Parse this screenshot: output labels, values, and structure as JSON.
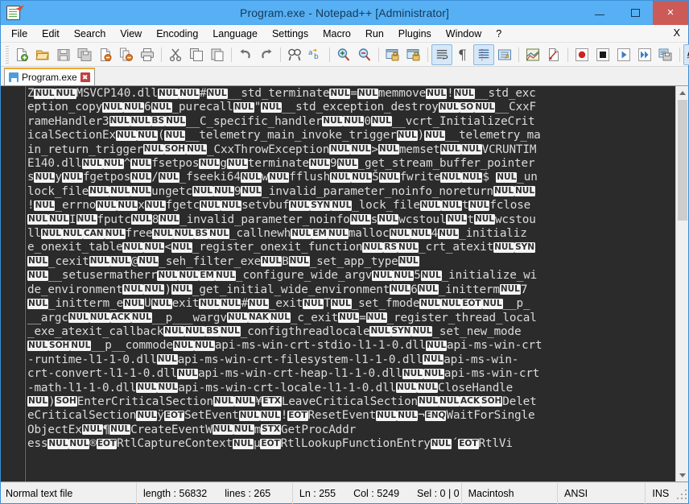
{
  "window": {
    "title": "Program.exe - Notepad++ [Administrator]",
    "icon": "notepad-plus-plus-icon",
    "minimize_label": "–",
    "maximize_label": "□",
    "close_label": "×"
  },
  "menu": {
    "items": [
      {
        "label": "File",
        "accel": "F"
      },
      {
        "label": "Edit",
        "accel": "E"
      },
      {
        "label": "Search",
        "accel": "S"
      },
      {
        "label": "View",
        "accel": "V"
      },
      {
        "label": "Encoding",
        "accel": "n"
      },
      {
        "label": "Language",
        "accel": "L"
      },
      {
        "label": "Settings",
        "accel": "t"
      },
      {
        "label": "Macro",
        "accel": "M"
      },
      {
        "label": "Run",
        "accel": "R"
      },
      {
        "label": "Plugins",
        "accel": "P"
      },
      {
        "label": "Window",
        "accel": "W"
      },
      {
        "label": "?",
        "accel": "?"
      }
    ],
    "close_doc_label": "X"
  },
  "toolbar": {
    "buttons": [
      {
        "name": "new-file-icon",
        "tip": "New"
      },
      {
        "name": "open-file-icon",
        "tip": "Open"
      },
      {
        "name": "save-icon",
        "tip": "Save"
      },
      {
        "name": "save-all-icon",
        "tip": "Save All"
      },
      {
        "name": "close-file-icon",
        "tip": "Close"
      },
      {
        "name": "close-all-files-icon",
        "tip": "Close All"
      },
      {
        "name": "print-icon",
        "tip": "Print"
      },
      {
        "name": "separator",
        "tip": ""
      },
      {
        "name": "cut-icon",
        "tip": "Cut"
      },
      {
        "name": "copy-icon",
        "tip": "Copy"
      },
      {
        "name": "paste-icon",
        "tip": "Paste"
      },
      {
        "name": "separator",
        "tip": ""
      },
      {
        "name": "undo-icon",
        "tip": "Undo"
      },
      {
        "name": "redo-icon",
        "tip": "Redo"
      },
      {
        "name": "separator",
        "tip": ""
      },
      {
        "name": "find-icon",
        "tip": "Find"
      },
      {
        "name": "replace-icon",
        "tip": "Replace"
      },
      {
        "name": "separator",
        "tip": ""
      },
      {
        "name": "zoom-in-icon",
        "tip": "Zoom In"
      },
      {
        "name": "zoom-out-icon",
        "tip": "Zoom Out"
      },
      {
        "name": "separator",
        "tip": ""
      },
      {
        "name": "sync-vertical-icon",
        "tip": "Synchronize Vertical Scrolling"
      },
      {
        "name": "sync-horizontal-icon",
        "tip": "Synchronize Horizontal Scrolling"
      },
      {
        "name": "separator",
        "tip": ""
      },
      {
        "name": "word-wrap-icon",
        "tip": "Word wrap",
        "active": true
      },
      {
        "name": "show-all-characters-icon",
        "tip": "Show All Characters"
      },
      {
        "name": "indent-guide-icon",
        "tip": "Show Indent Guide",
        "active": true
      },
      {
        "name": "user-defined-dialog-icon",
        "tip": "User Defined Dialogue"
      },
      {
        "name": "separator",
        "tip": ""
      },
      {
        "name": "document-map-icon",
        "tip": "Document Map"
      },
      {
        "name": "function-list-icon",
        "tip": "Function List"
      },
      {
        "name": "separator",
        "tip": ""
      },
      {
        "name": "record-macro-icon",
        "tip": "Start Recording"
      },
      {
        "name": "stop-macro-icon",
        "tip": "Stop Recording"
      },
      {
        "name": "play-macro-icon",
        "tip": "Playback"
      },
      {
        "name": "run-macro-multiple-icon",
        "tip": "Run a Macro Multiple Times"
      },
      {
        "name": "save-macro-icon",
        "tip": "Save Current Recorded Macro"
      },
      {
        "name": "separator",
        "tip": ""
      },
      {
        "name": "spell-check-icon",
        "tip": "Spell Checker",
        "active": true
      },
      {
        "name": "hide-lines-icon",
        "tip": "Hide Lines"
      },
      {
        "name": "folder-as-workspace-icon",
        "tip": "Folder as Workspace"
      }
    ]
  },
  "tabs": [
    {
      "label": "Program.exe",
      "icon": "saved-document-icon",
      "close_label": "✖",
      "active": true
    }
  ],
  "editor": {
    "scrollbar": {
      "up_arrow": "arrow-up-icon",
      "down_arrow": "arrow-down-icon"
    },
    "lines": [
      "Z{NUL}{NUL}MSVCP140.dll{NUL}{NUL}#{NUL}__std_terminate{NUL}={NUL}memmove{NUL}!{NUL}__std_exc",
      "eption_copy{NUL}{NUL}6{NUL}_purecall{NUL}\"{NUL}__std_exception_destroy{NUL}{SO}{NUL}__CxxF",
      "rameHandler3{NUL}{NUL}{BS}{NUL}__C_specific_handler{NUL}{NUL}0{NUL}__vcrt_InitializeCrit",
      "icalSectionEx{NUL}{NUL}({NUL}__telemetry_main_invoke_trigger{NUL}){NUL}__telemetry_ma",
      "in_return_trigger{NUL}{SOH}{NUL}_CxxThrowException{NUL}{NUL}>{NUL}memset{NUL}{NUL}VCRUNTIM",
      "E140.dll{NUL}{NUL}^{NUL}fsetpos{NUL}g{NUL}terminate{NUL}9{NUL}_get_stream_buffer_pointer",
      "s{NUL}y{NUL}fgetpos{NUL}/{NUL}_fseeki64{NUL}w{NUL}fflush{NUL}{NUL}Š{NUL}fwrite{NUL}{NUL}$ {NUL}_un",
      "lock_file{NUL}{NUL}{NUL}ungetc{NUL}{NUL}9{NUL}_invalid_parameter_noinfo_noreturn{NUL}{NUL}",
      "!{NUL}_errno{NUL}{NUL}x{NUL}fgetc{NUL}{NUL}setvbuf{NUL}{SYN}{NUL}_lock_file{NUL}{NUL}t{NUL}fclose",
      "{NUL}{NUL}I{NUL}fputc{NUL}8{NUL}_invalid_parameter_noinfo{NUL}s{NUL}wcstoul{NUL}t{NUL}wcstou",
      "ll{NUL}{NUL}{CAN}{NUL}free{NUL}{NUL}{BS}{NUL}_callnewh{NUL}{EM}{NUL}malloc{NUL}{NUL}4{NUL}_initializ",
      "e_onexit_table{NUL}{NUL}<{NUL}_register_onexit_function{NUL}{RS}{NUL}_crt_atexit{NUL}{SYN}",
      "{NUL}_cexit{NUL}{NUL}@{NUL}_seh_filter_exe{NUL}B{NUL}_set_app_type{NUL}",
      "{NUL}__setusermatherr{NUL}{NUL}{EM}{NUL}_configure_wide_argv{NUL}{NUL}5{NUL}_initialize_wi",
      "de_environment{NUL}{NUL}){NUL}_get_initial_wide_environment{NUL}6{NUL}_initterm{NUL}7",
      "{NUL}_initterm_e{NUL}U{NUL}exit{NUL}{NUL}#{NUL}_exit{NUL}T{NUL}_set_fmode{NUL}{NUL}{EOT}{NUL}__p_",
      "__argc{NUL}{NUL}{ACK}{NUL}__p___wargv{NUL}{NAK}{NUL}_c_exit{NUL}={NUL}_register_thread_local",
      "_exe_atexit_callback{NUL}{NUL}{BS}{NUL}_configthreadlocale{NUL}{SYN}{NUL}_set_new_mode",
      "{NUL}{SOH}{NUL}__p__commode{NUL}{NUL}api-ms-win-crt-stdio-l1-1-0.dll{NUL}api-ms-win-crt",
      "-runtime-l1-1-0.dll{NUL}api-ms-win-crt-filesystem-l1-1-0.dll{NUL}api-ms-win-",
      "crt-convert-l1-1-0.dll{NUL}api-ms-win-crt-heap-l1-1-0.dll{NUL}{NUL}api-ms-win-crt",
      "-math-l1-1-0.dll{NUL}{NUL}api-ms-win-crt-locale-l1-1-0.dll{NUL}{NUL}CloseHandle",
      "{NUL}){SOH}EnterCriticalSection{NUL}{NUL}¥{ETX}LeaveCriticalSection{NUL}{NUL}{ACK}{SOH}Delet",
      "eCriticalSection{NUL}ÿ{EOT}SetEvent{NUL}{NUL}!{EOT}ResetEvent{NUL}{NUL}¬{ENQ}WaitForSingle",
      "ObjectEx{NUL}¶{NUL}CreateEventW{NUL}{NUL}m{STX}GetProcAddr",
      "ess{NUL}{NUL}®{EOT}RtlCaptureContext{NUL}µ{EOT}RtlLookupFunctionEntry{NUL}´{EOT}RtlVi"
    ]
  },
  "statusbar": {
    "file_type": "Normal text file",
    "length_label": "length : 56832",
    "lines_label": "lines : 265",
    "ln_label": "Ln : 255",
    "col_label": "Col : 5249",
    "sel_label": "Sel : 0 | 0",
    "eol": "Macintosh",
    "encoding": "ANSI",
    "insert_mode": "INS"
  },
  "colors": {
    "title_bar": "#56b0f3",
    "close_button": "#cc5a57",
    "editor_background": "#2b2b2b",
    "editor_text": "#dcdcdc",
    "control_char_background": "#f4f4f4",
    "tab_active_top": "#f0a830"
  }
}
